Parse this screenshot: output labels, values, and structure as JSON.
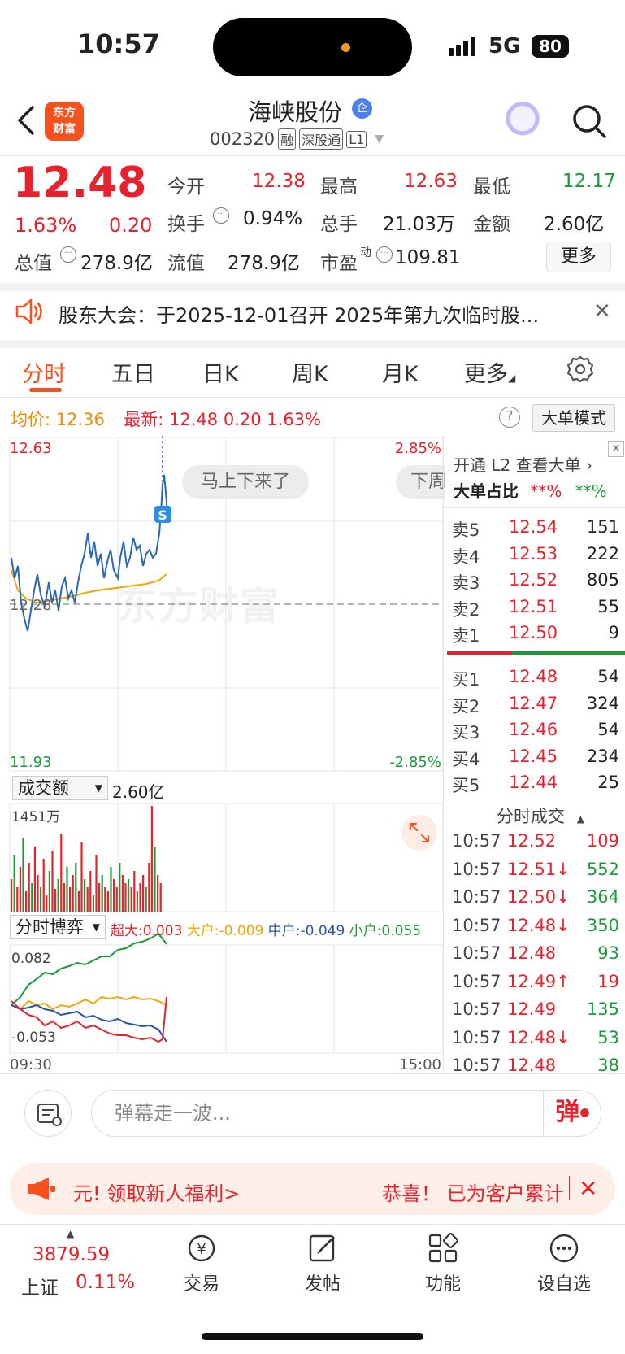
{
  "status_bar": {
    "time": "10:57",
    "network": "5G",
    "battery": "80"
  },
  "header": {
    "logo_line1": "东方",
    "logo_line2": "财富",
    "stock_name": "海峡股份",
    "verify_badge": "企",
    "code": "002320",
    "tags": [
      "融",
      "深股通",
      "L1"
    ]
  },
  "quote": {
    "price": "12.48",
    "change_pct": "1.63%",
    "change": "0.20",
    "open_label": "今开",
    "open": "12.38",
    "high_label": "最高",
    "high": "12.63",
    "low_label": "最低",
    "low": "12.17",
    "turnover_label": "换手",
    "turnover": "0.94%",
    "volume_label": "总手",
    "volume": "21.03万",
    "amount_label": "金额",
    "amount": "2.60亿",
    "mktcap_label": "总值",
    "mktcap": "278.9亿",
    "float_label": "流值",
    "float_cap": "278.9亿",
    "pe_label": "市盈",
    "pe_sup": "动",
    "pe": "109.81",
    "more_label": "更多"
  },
  "notice": {
    "text": "股东大会：于2025-12-01召开 2025年第九次临时股..."
  },
  "tabs": [
    "分时",
    "五日",
    "日K",
    "周K",
    "月K",
    "更多"
  ],
  "price_info": {
    "avg_label": "均价:",
    "avg": "12.36",
    "latest_label": "最新:",
    "latest": "12.48",
    "change": "0.20",
    "pct": "1.63%",
    "mode_button": "大单模式"
  },
  "chart_labels": {
    "y_max": "12.63",
    "y_min": "11.93",
    "y_mid": "12.28",
    "pct_max": "2.85%",
    "pct_min": "-2.85%",
    "marker": "S",
    "watermark": "东方财富",
    "barrage_1": "马上下来了",
    "barrage_2": "下周",
    "volume_selector": "成交额",
    "volume_total": "2.60亿",
    "volume_max": "1451万",
    "game_selector": "分时博弈",
    "legend": [
      {
        "label": "超大:",
        "value": "0.003",
        "color": "#e8222d"
      },
      {
        "label": "大户:",
        "value": "-0.009",
        "color": "#f0a800"
      },
      {
        "label": "中户:",
        "value": "-0.049",
        "color": "#2a55a8"
      },
      {
        "label": "小户:",
        "value": "0.055",
        "color": "#1a9b3a"
      }
    ],
    "game_max": "0.082",
    "game_min": "-0.053",
    "time_start": "09:30",
    "time_end": "15:00"
  },
  "order_book": {
    "promo": "开通 L2 查看大单",
    "big_ratio_label": "大单占比",
    "big_ratio_red": "**%",
    "big_ratio_green": "**%",
    "asks": [
      {
        "label": "卖5",
        "price": "12.54",
        "vol": "151"
      },
      {
        "label": "卖4",
        "price": "12.53",
        "vol": "222"
      },
      {
        "label": "卖3",
        "price": "12.52",
        "vol": "805"
      },
      {
        "label": "卖2",
        "price": "12.51",
        "vol": "55"
      },
      {
        "label": "卖1",
        "price": "12.50",
        "vol": "9"
      }
    ],
    "bids": [
      {
        "label": "买1",
        "price": "12.48",
        "vol": "54"
      },
      {
        "label": "买2",
        "price": "12.47",
        "vol": "324"
      },
      {
        "label": "买3",
        "price": "12.46",
        "vol": "54"
      },
      {
        "label": "买4",
        "price": "12.45",
        "vol": "234"
      },
      {
        "label": "买5",
        "price": "12.44",
        "vol": "25"
      }
    ],
    "trades_title": "分时成交",
    "trades": [
      {
        "time": "10:57",
        "price": "12.52",
        "vol": "109",
        "dir": "",
        "vol_color": "red"
      },
      {
        "time": "10:57",
        "price": "12.51↓",
        "vol": "552",
        "dir": "down",
        "vol_color": "green"
      },
      {
        "time": "10:57",
        "price": "12.50↓",
        "vol": "364",
        "dir": "down",
        "vol_color": "green"
      },
      {
        "time": "10:57",
        "price": "12.48↓",
        "vol": "350",
        "dir": "down",
        "vol_color": "green"
      },
      {
        "time": "10:57",
        "price": "12.48",
        "vol": "93",
        "dir": "",
        "vol_color": "green"
      },
      {
        "time": "10:57",
        "price": "12.49↑",
        "vol": "19",
        "dir": "up",
        "vol_color": "red"
      },
      {
        "time": "10:57",
        "price": "12.49",
        "vol": "135",
        "dir": "",
        "vol_color": "green"
      },
      {
        "time": "10:57",
        "price": "12.48↓",
        "vol": "53",
        "dir": "down",
        "vol_color": "green"
      },
      {
        "time": "10:57",
        "price": "12.48",
        "vol": "38",
        "dir": "",
        "vol_color": "green"
      }
    ]
  },
  "comment": {
    "placeholder": "弹幕走一波...",
    "danmu_btn": "弹"
  },
  "promo_banner": {
    "left": "元! 领取新人福利>",
    "right": "恭喜！ 已为客户累计"
  },
  "bottom_nav": {
    "index_value": "3879.59",
    "index_name": "上证",
    "index_pct": "0.11%",
    "items": [
      "交易",
      "发帖",
      "功能",
      "设自选"
    ]
  },
  "colors": {
    "up": "#e8222d",
    "down": "#1a9b3a",
    "brand": "#f4511e",
    "avg_line": "#f0a800",
    "price_line": "#2a67b8"
  }
}
